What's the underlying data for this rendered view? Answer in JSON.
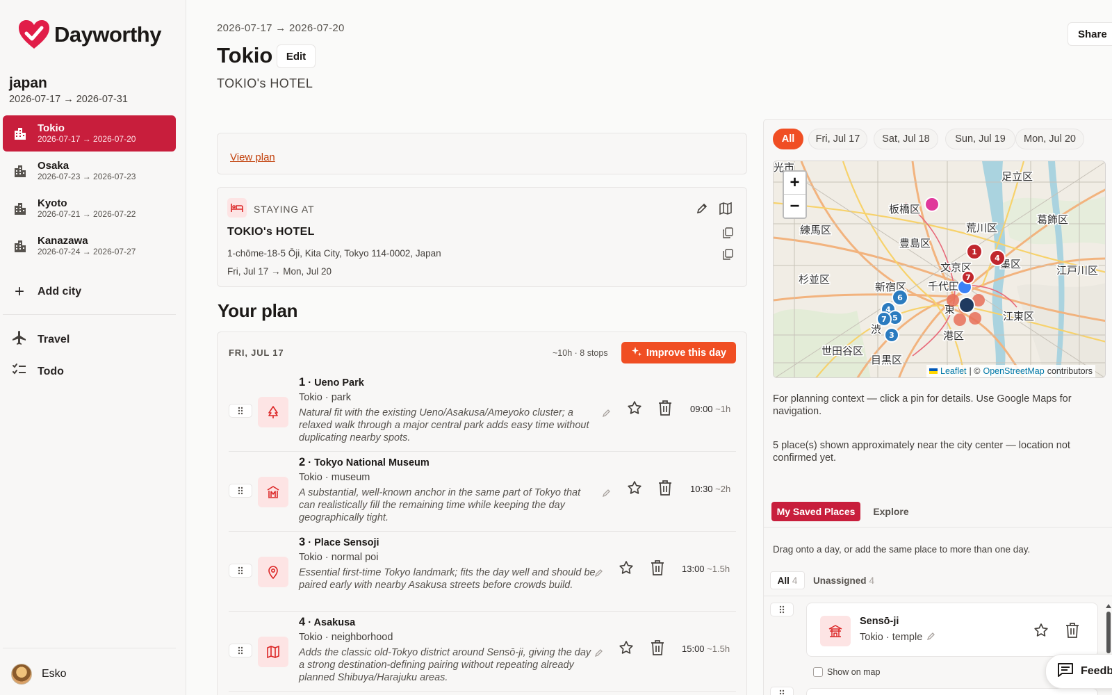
{
  "app": {
    "name": "Dayworthy"
  },
  "trip": {
    "name": "japan",
    "dates": "2026-07-17 → 2026-07-31"
  },
  "cities": [
    {
      "name": "Tokio",
      "dates": "2026-07-17 → 2026-07-20",
      "active": true
    },
    {
      "name": "Osaka",
      "dates": "2026-07-23 → 2026-07-23"
    },
    {
      "name": "Kyoto",
      "dates": "2026-07-21 → 2026-07-22"
    },
    {
      "name": "Kanazawa",
      "dates": "2026-07-24 → 2026-07-27"
    }
  ],
  "sidebar": {
    "add_city": "Add city",
    "travel": "Travel",
    "todo": "Todo",
    "user": "Esko"
  },
  "header": {
    "date_range": "2026-07-17 → 2026-07-20",
    "title": "Tokio",
    "edit": "Edit",
    "subtitle": "TOKIO's HOTEL",
    "share": "Share"
  },
  "view_plan": "View plan",
  "stay": {
    "label": "STAYING AT",
    "name": "TOKIO's HOTEL",
    "address": "1-chōme-18-5 Ōji, Kita City, Tokyo 114-0002, Japan",
    "dates": "Fri, Jul 17 → Mon, Jul 20"
  },
  "plan": {
    "heading": "Your plan",
    "day_label": "FRI, JUL 17",
    "day_meta": "~10h · 8 stops",
    "improve": "Improve this day",
    "stops": [
      {
        "num": "1",
        "name": "Ueno Park",
        "sub": "Tokio · park",
        "desc": "Natural fit with the existing Ueno/Asakusa/Ameyoko cluster; a relaxed walk through a major central park adds easy time without duplicating nearby spots.",
        "time": "09:00",
        "dur": "~1h",
        "icon": "tree-icon"
      },
      {
        "num": "2",
        "name": "Tokyo National Museum",
        "sub": "Tokio · museum",
        "desc": "A substantial, well-known anchor in the same part of Tokyo that can realistically fill the remaining time while keeping the day geographically tight.",
        "time": "10:30",
        "dur": "~2h",
        "icon": "museum-icon"
      },
      {
        "num": "3",
        "name": "Place Sensoji",
        "sub": "Tokio · normal poi",
        "desc": "Essential first-time Tokyo landmark; fits the day well and should be paired early with nearby Asakusa streets before crowds build.",
        "time": "13:00",
        "dur": "~1.5h",
        "icon": "pin-icon"
      },
      {
        "num": "4",
        "name": "Asakusa",
        "sub": "Tokio · neighborhood",
        "desc": "Adds the classic old-Tokyo district around Sensō-ji, giving the day a strong destination-defining pairing without repeating already planned Shibuya/Harajuku areas.",
        "time": "15:00",
        "dur": "~1.5h",
        "icon": "map-icon"
      }
    ]
  },
  "day_chips": [
    "All",
    "Fri, Jul 17",
    "Sat, Jul 18",
    "Sun, Jul 19",
    "Mon, Jul 20"
  ],
  "map": {
    "zoom_in": "+",
    "zoom_out": "−",
    "attribution_leaflet": "Leaflet",
    "attribution_sep": "| ©",
    "attribution_osm": "OpenStreetMap",
    "attribution_tail": "contributors",
    "labels": [
      "光市",
      "足立区",
      "板橋区",
      "葛飾区",
      "練馬区",
      "荒川区",
      "豊島区",
      "文京区",
      "江戸川区",
      "杉並区",
      "新宿区",
      "千代田",
      "江東区",
      "渋",
      "港区",
      "世田谷区",
      "目黒区",
      "東",
      "墨区"
    ]
  },
  "notes": {
    "map_note": "For planning context — click a pin for details. Use Google Maps for navigation.",
    "approx_note": "5 place(s) shown approximately near the city center — location not confirmed yet."
  },
  "saved": {
    "tab_saved": "My Saved Places",
    "tab_explore": "Explore",
    "drag_note": "Drag onto a day, or add the same place to more than one day.",
    "filter_all": "All",
    "filter_all_count": "4",
    "filter_unassigned": "Unassigned",
    "filter_unassigned_count": "4",
    "item_name": "Sensō-ji",
    "item_sub": "Tokio · temple",
    "show_on_map": "Show on map"
  },
  "feedback": "Feedback",
  "colors": {
    "brand": "#c81e3c",
    "accent": "#f04e23"
  }
}
